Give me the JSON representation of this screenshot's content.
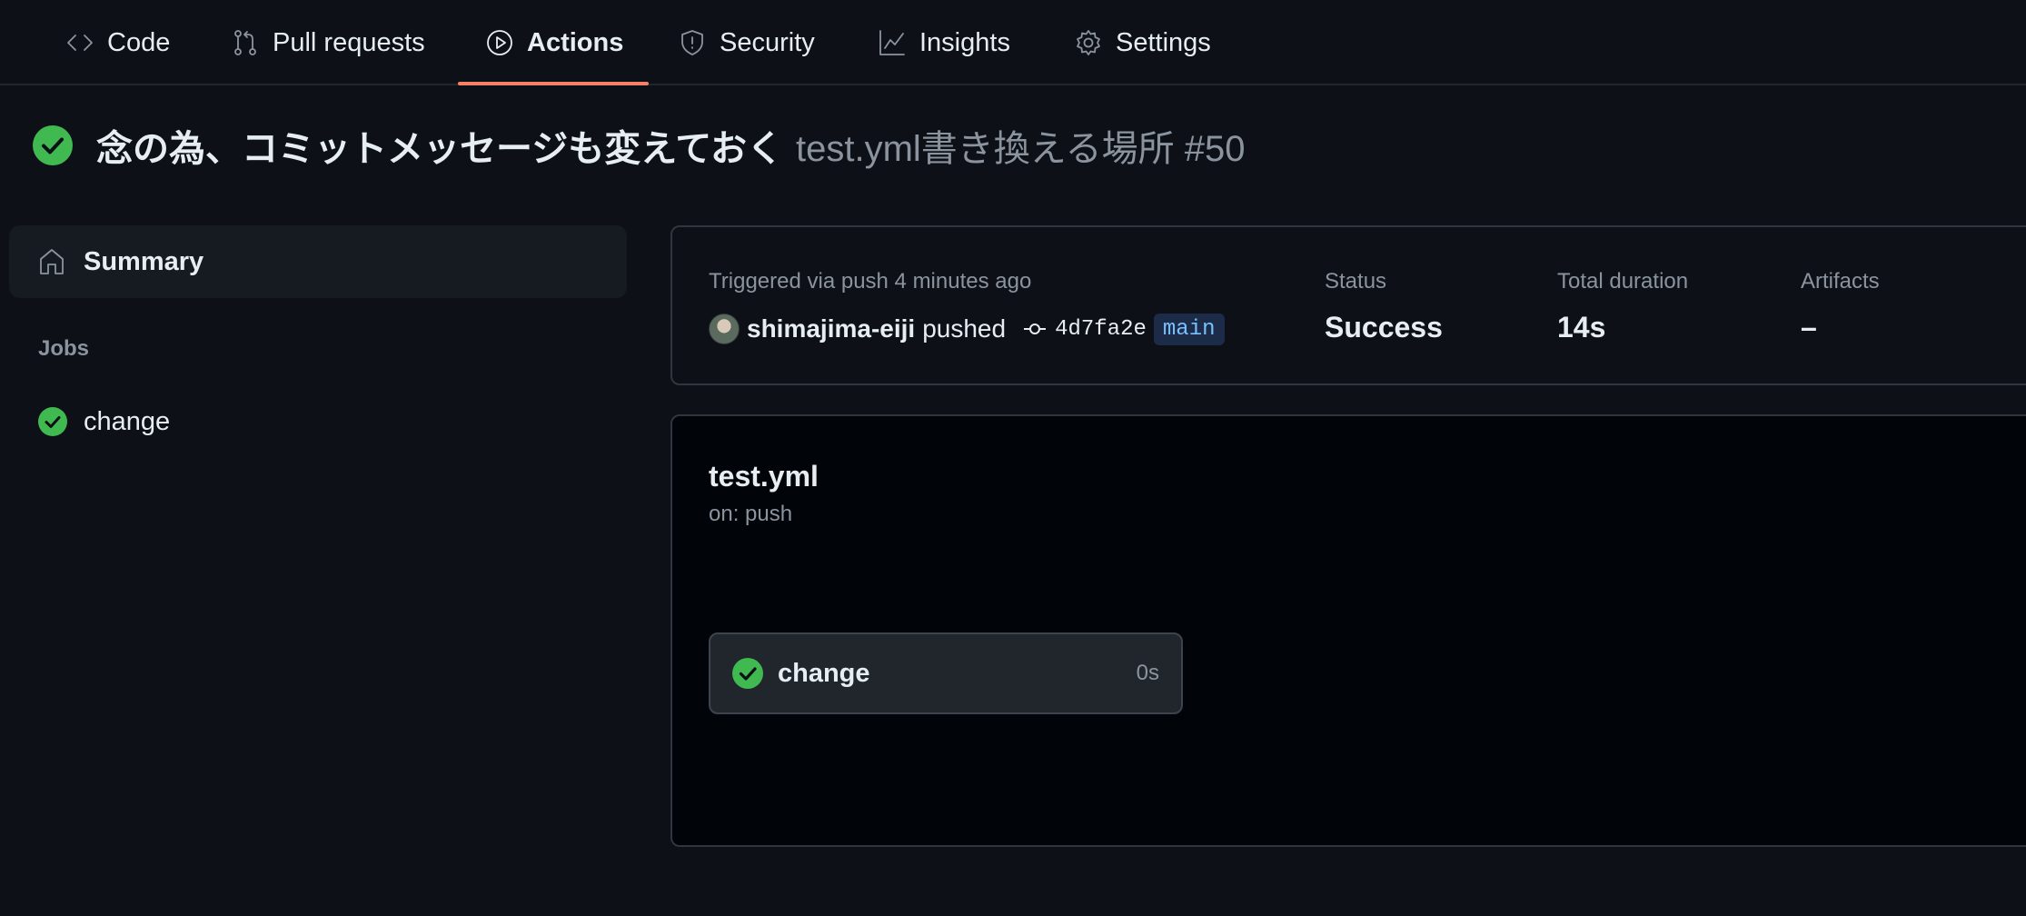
{
  "nav": {
    "tabs": [
      {
        "label": "Code",
        "icon": "code-icon"
      },
      {
        "label": "Pull requests",
        "icon": "pull-request-icon"
      },
      {
        "label": "Actions",
        "icon": "play-icon",
        "active": true
      },
      {
        "label": "Security",
        "icon": "shield-icon"
      },
      {
        "label": "Insights",
        "icon": "graph-icon"
      },
      {
        "label": "Settings",
        "icon": "gear-icon"
      }
    ],
    "active_underline_color": "#f78166"
  },
  "run": {
    "title": "念の為、コミットメッセージも変えておく",
    "subtitle": "test.yml書き換える場所 #50",
    "status_color": "#3fb950"
  },
  "sidebar": {
    "summary_label": "Summary",
    "jobs_heading": "Jobs",
    "jobs": [
      {
        "label": "change"
      }
    ]
  },
  "info": {
    "trigger_text": "Triggered via push 4 minutes ago",
    "pusher": "shimajima-eiji",
    "pushed_word": "pushed",
    "commit_sha": "4d7fa2e",
    "branch": "main",
    "status_label": "Status",
    "status_value": "Success",
    "duration_label": "Total duration",
    "duration_value": "14s",
    "artifacts_label": "Artifacts",
    "artifacts_value": "–"
  },
  "workflow": {
    "name": "test.yml",
    "trigger": "on: push",
    "job": {
      "name": "change",
      "duration": "0s"
    }
  }
}
